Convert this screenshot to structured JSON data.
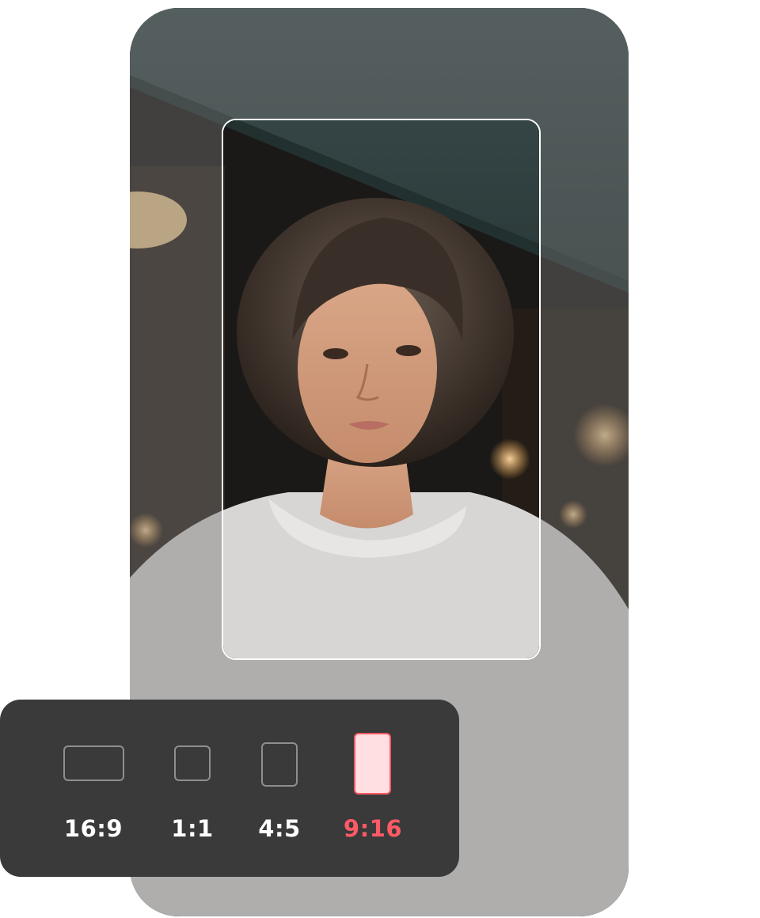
{
  "aspect_ratio_selector": {
    "options": [
      {
        "label": "16:9",
        "selected": false
      },
      {
        "label": "1:1",
        "selected": false
      },
      {
        "label": "4:5",
        "selected": false
      },
      {
        "label": "9:16",
        "selected": true
      }
    ]
  },
  "colors": {
    "accent": "#ff5a66",
    "accent_fill": "#ffdfe1",
    "panel_background": "#3a3a3a",
    "crop_frame": "#ffffff"
  }
}
